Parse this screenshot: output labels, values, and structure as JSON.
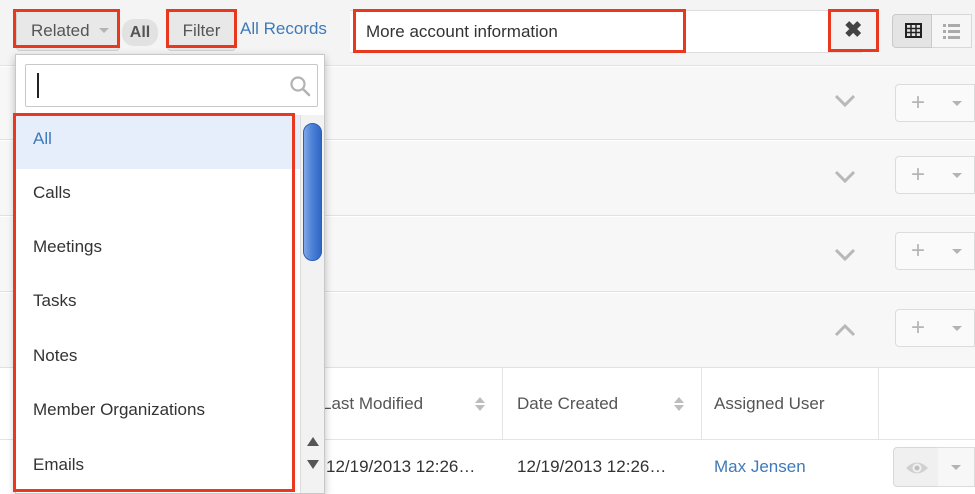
{
  "toolbar": {
    "related_label": "Related",
    "all_label": "All",
    "filter_label": "Filter",
    "all_records_label": "All Records",
    "search_value": "More account information",
    "clear_symbol": "✖"
  },
  "dropdown": {
    "search_value": "",
    "items": [
      {
        "label": "All",
        "active": true
      },
      {
        "label": "Calls",
        "active": false
      },
      {
        "label": "Meetings",
        "active": false
      },
      {
        "label": "Tasks",
        "active": false
      },
      {
        "label": "Notes",
        "active": false
      },
      {
        "label": "Member Organizations",
        "active": false
      },
      {
        "label": "Emails",
        "active": false
      }
    ]
  },
  "panels": [
    {
      "state": "collapsed"
    },
    {
      "state": "collapsed"
    },
    {
      "state": "collapsed"
    },
    {
      "state": "expanded"
    }
  ],
  "table": {
    "columns": [
      "Last Modified",
      "Date Created",
      "Assigned User"
    ],
    "rows": [
      {
        "last_modified": "12/19/2013 12:26…",
        "date_created": "12/19/2013 12:26…",
        "assigned_user": "Max Jensen"
      }
    ]
  },
  "colors": {
    "highlight": "#e8391e",
    "link": "#3e7ab8",
    "active_item_bg": "#e6eefb"
  },
  "icons": {
    "search": "search-icon",
    "clear": "close-icon",
    "collapse": "chevron-down-icon",
    "expand": "chevron-up-icon",
    "add": "plus-icon",
    "preview": "eye-icon",
    "grid_view": "grid-view-icon",
    "list_view": "list-view-icon"
  }
}
